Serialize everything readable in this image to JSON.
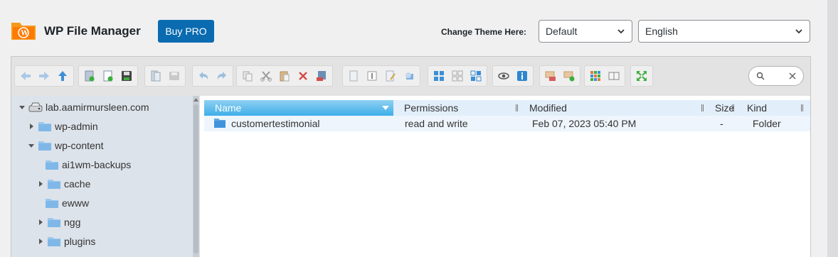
{
  "header": {
    "app_title": "WP File Manager",
    "buy_pro_label": "Buy PRO",
    "theme_label": "Change Theme Here:",
    "theme_selected": "Default",
    "language_selected": "English",
    "brand_color": "#0a6bb1"
  },
  "toolbar": {
    "groups": [
      [
        "back-icon",
        "forward-icon",
        "up-icon"
      ],
      [
        "mkdir-icon",
        "mkfile-icon",
        "upload-icon"
      ],
      [
        "open-icon",
        "download-icon"
      ],
      [
        "undo-icon",
        "redo-icon"
      ],
      [
        "copy-icon",
        "cut-icon",
        "paste-icon",
        "delete-icon",
        "empty-icon"
      ],
      [
        "duplicate-icon",
        "rename-icon",
        "edit-icon",
        "resize-icon"
      ],
      [
        "select-all-icon",
        "select-none-icon",
        "invert-icon"
      ],
      [
        "preview-icon",
        "info-icon"
      ],
      [
        "extract-icon",
        "archive-icon"
      ],
      [
        "view-icon",
        "sort-icon"
      ],
      [
        "fullscreen-icon"
      ]
    ]
  },
  "tree": {
    "items": [
      {
        "label": "lab.aamirmursleen.com",
        "expanded": true,
        "level": 0,
        "type": "drive"
      },
      {
        "label": "wp-admin",
        "expanded": false,
        "level": 1,
        "type": "folder"
      },
      {
        "label": "wp-content",
        "expanded": true,
        "level": 1,
        "type": "folder"
      },
      {
        "label": "ai1wm-backups",
        "level": 2,
        "type": "folder",
        "no_arrow": true
      },
      {
        "label": "cache",
        "expanded": false,
        "level": 2,
        "type": "folder"
      },
      {
        "label": "ewww",
        "level": 2,
        "type": "folder",
        "no_arrow": true
      },
      {
        "label": "ngg",
        "expanded": false,
        "level": 2,
        "type": "folder"
      },
      {
        "label": "plugins",
        "expanded": false,
        "level": 2,
        "type": "folder"
      }
    ]
  },
  "list": {
    "columns": {
      "name": "Name",
      "permissions": "Permissions",
      "modified": "Modified",
      "size": "Size",
      "kind": "Kind"
    },
    "rows": [
      {
        "name": "customertestimonial",
        "permissions": "read and write",
        "modified": "Feb 07, 2023 05:40 PM",
        "size": "-",
        "kind": "Folder"
      }
    ]
  }
}
